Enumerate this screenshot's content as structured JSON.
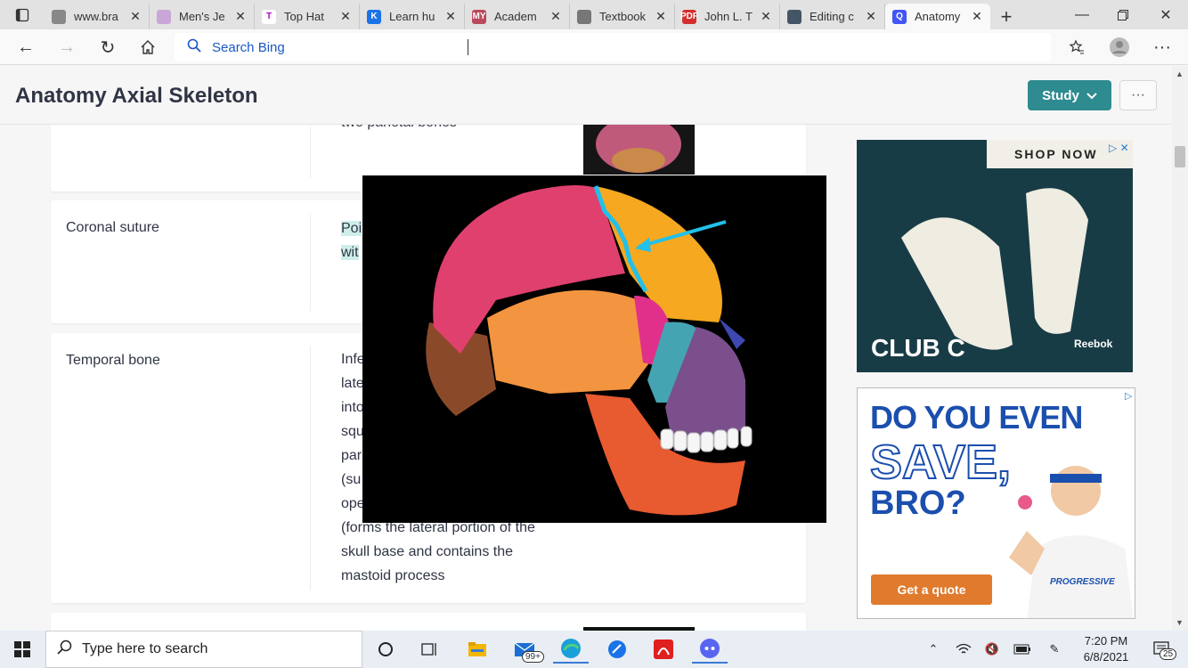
{
  "browser": {
    "tabs": [
      {
        "label": "www.bra",
        "fav_color": "#888888",
        "fav_text": ""
      },
      {
        "label": "Men's Je",
        "fav_color": "#c9a6d8",
        "fav_text": ""
      },
      {
        "label": "Top Hat",
        "fav_color": "#ffffff",
        "fav_text": "T"
      },
      {
        "label": "Learn hu",
        "fav_color": "#1a73e8",
        "fav_text": "K"
      },
      {
        "label": "Academ",
        "fav_color": "#b84a5e",
        "fav_text": "MY"
      },
      {
        "label": "Textbook",
        "fav_color": "#777777",
        "fav_text": ""
      },
      {
        "label": "John L. T",
        "fav_color": "#d32f2f",
        "fav_text": "PDF"
      },
      {
        "label": "Editing c",
        "fav_color": "#445566",
        "fav_text": ""
      },
      {
        "label": "Anatomy",
        "fav_color": "#4257f5",
        "fav_text": "Q"
      }
    ],
    "search_placeholder": "Search Bing"
  },
  "page": {
    "title": "Anatomy Axial Skeleton",
    "study_label": "Study",
    "more_label": "···"
  },
  "cards": [
    {
      "term": "",
      "definition": "two parietal bones"
    },
    {
      "term": "Coronal suture",
      "definition_line1": "Poi",
      "definition_line2": "wit"
    },
    {
      "term": "Temporal bone",
      "lines": [
        "Infe",
        "late",
        "into",
        "squ",
        "par",
        "(su",
        "ope",
        "(forms the lateral portion of the",
        "skull base and contains the",
        "mastoid process"
      ]
    }
  ],
  "ads": {
    "ad1": {
      "shop_now": "SHOP NOW",
      "brand_line": "CLUB C",
      "brand": "Reebok"
    },
    "ad2": {
      "headline1": "DO YOU EVEN",
      "headline2": "SAVE,",
      "headline3": "BRO?",
      "cta": "Get a quote",
      "brand": "PROGRESSIVE"
    }
  },
  "taskbar": {
    "search_placeholder": "Type here to search",
    "mail_badge": "99+",
    "time": "7:20 PM",
    "date": "6/8/2021",
    "notif_count": "25"
  },
  "colors": {
    "accent": "#2e8b8f",
    "highlight": "#cfeee9",
    "link": "#1a57c4"
  }
}
